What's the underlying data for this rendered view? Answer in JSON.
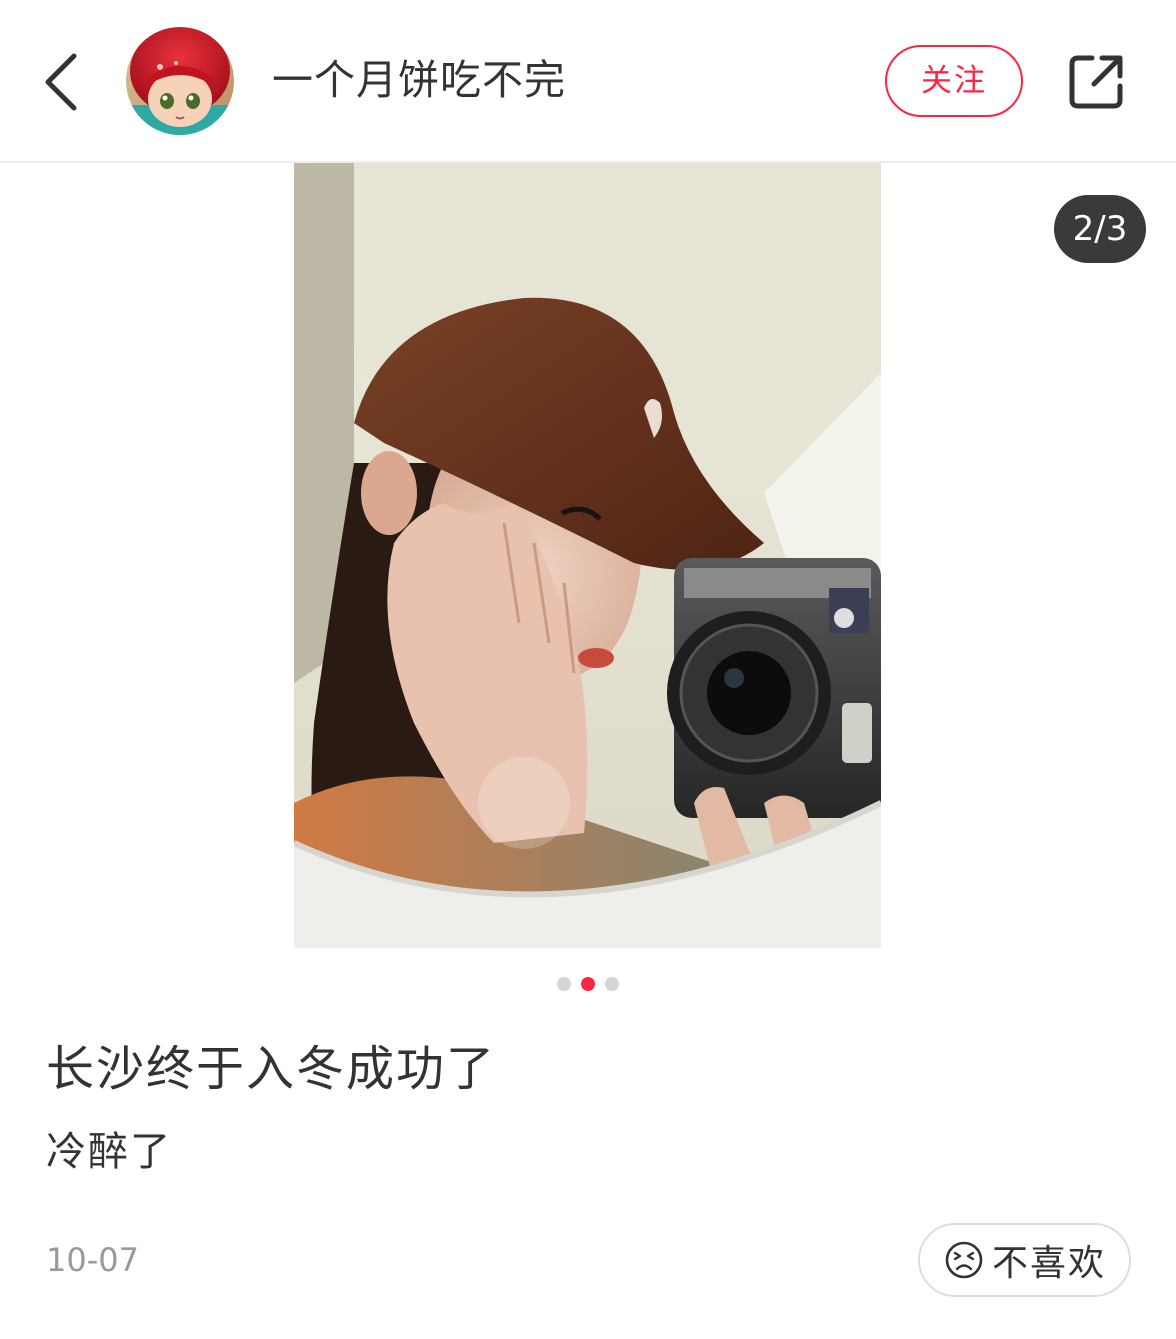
{
  "header": {
    "author_name": "一个月饼吃不完",
    "follow_label": "关注",
    "icons": {
      "back": "back-arrow-icon",
      "share": "share-icon"
    }
  },
  "carousel": {
    "counter": "2/3",
    "current_index": 2,
    "total": 3
  },
  "note": {
    "title": "长沙终于入冬成功了",
    "description": "冷醉了",
    "date": "10-07",
    "dislike_label": "不喜欢"
  },
  "colors": {
    "accent": "#ff2442",
    "text": "#333333",
    "muted": "#999999",
    "counter_bg": "#3a3a3a"
  }
}
